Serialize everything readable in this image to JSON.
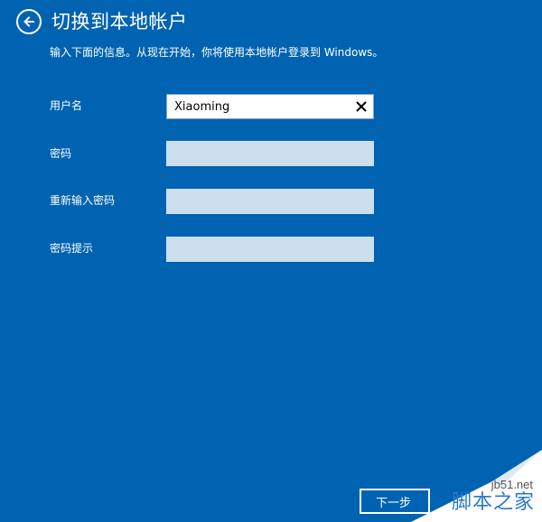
{
  "header": {
    "back_icon": "back-arrow-icon",
    "title": "切换到本地帐户",
    "subtitle": "输入下面的信息。从现在开始，你将使用本地帐户登录到 Windows。"
  },
  "form": {
    "username_label": "用户名",
    "username_value": "Xiaoming",
    "clear_icon": "close-icon",
    "password_label": "密码",
    "password_value": "",
    "confirm_label": "重新输入密码",
    "confirm_value": "",
    "hint_label": "密码提示",
    "hint_value": ""
  },
  "footer": {
    "next_label": "下一步"
  },
  "watermark": {
    "site": "jb51.net",
    "name": "脚本之家"
  },
  "colors": {
    "background": "#0063b1",
    "input_empty": "#ccdfee",
    "text": "#ffffff"
  }
}
